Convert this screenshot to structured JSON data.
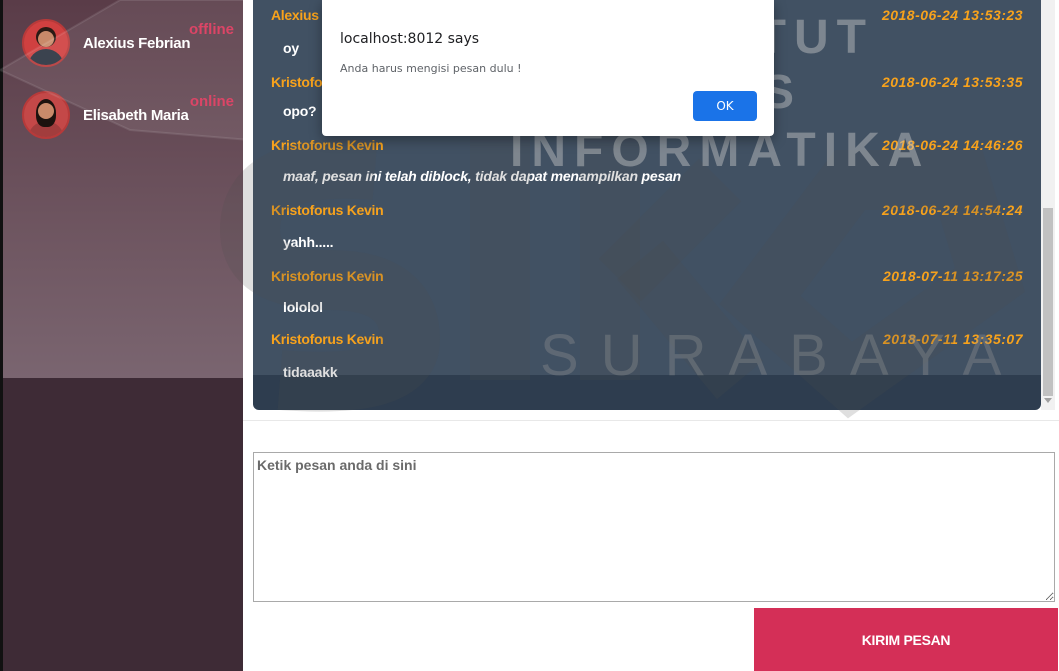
{
  "sidebar": {
    "contacts": [
      {
        "name": "Alexius Febrian",
        "status": "offline"
      },
      {
        "name": "Elisabeth Maria",
        "status": "online"
      }
    ]
  },
  "chat": {
    "messages": [
      {
        "sender": "Alexius",
        "time": "2018-06-24 13:53:23",
        "text": "oy"
      },
      {
        "sender": "Kristofo",
        "time": "2018-06-24 13:53:35",
        "text": "opo?"
      },
      {
        "sender": "Kristoforus Kevin",
        "time": "2018-06-24 14:46:26",
        "text": "maaf, pesan ini telah diblock, tidak dapat menampilkan pesan"
      },
      {
        "sender": "Kristoforus Kevin",
        "time": "2018-06-24 14:54:24",
        "text": "yahh....."
      },
      {
        "sender": "Kristoforus Kevin",
        "time": "2018-07-11 13:17:25",
        "text": "lololol"
      },
      {
        "sender": "Kristoforus Kevin",
        "time": "2018-07-11 13:35:07",
        "text": "tidaaakk"
      }
    ]
  },
  "composer": {
    "placeholder": "Ketik pesan anda di sini",
    "send_label": "KIRIM PESAN"
  },
  "alert": {
    "title": "localhost:8012 says",
    "message": "Anda harus mengisi pesan dulu !",
    "ok_label": "OK"
  },
  "watermark": {
    "line1": "INSTITUT BISNIS",
    "line2": "DAN INFORMATIKA",
    "line3": "SURABAYA"
  },
  "colors": {
    "sender_accent": "#f7a21c",
    "status_accent": "#d9365a",
    "send_button": "#d42f57",
    "chat_bg": "#2e3d4f",
    "sidebar_bg": "#3e2b36"
  }
}
